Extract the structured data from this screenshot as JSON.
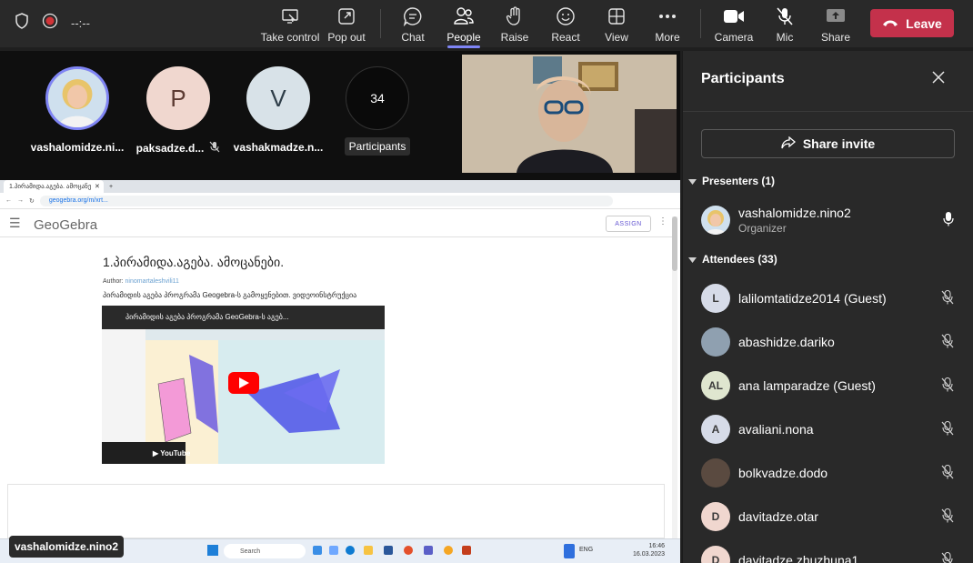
{
  "topbar": {
    "timer": "--:--",
    "buttons": {
      "take_control": "Take control",
      "pop_out": "Pop out",
      "chat": "Chat",
      "people": "People",
      "raise": "Raise",
      "react": "React",
      "view": "View",
      "more": "More",
      "camera": "Camera",
      "mic": "Mic",
      "share": "Share"
    },
    "leave": "Leave"
  },
  "stage": {
    "tiles": [
      {
        "name": "vashalomidze.ni...",
        "initial": ""
      },
      {
        "name": "paksadze.d...",
        "initial": "P"
      },
      {
        "name": "vashakmadze.n...",
        "initial": "V"
      },
      {
        "name": "Participants",
        "initial": "34"
      }
    ],
    "shared": {
      "tab_title": "1.პირამიდა.აგება. ამოცანები.",
      "url": "geogebra.org/m/xrt...",
      "logo": "GeoGebra",
      "assign": "ASSIGN",
      "doc_title": "1.პირამიდა.აგება. ამოცანები.",
      "author_label": "Author:",
      "author": "ninomartaleshvili11",
      "description": "პირამიდის აგება პროგრამა Geogebra-ს გამოყენებით. ვიდეოინსტრუქცია",
      "video_title": "პირამიდის აგება პროგრამა GeoGebra-ს აგებ...",
      "search_placeholder": "Search",
      "clock_time": "16:46",
      "clock_date": "16.03.2023",
      "lang": "ENG"
    },
    "presenter_tag": "vashalomidze.nino2"
  },
  "panel": {
    "title": "Participants",
    "share_invite": "Share invite",
    "presenters_label": "Presenters (1)",
    "attendees_label": "Attendees (33)",
    "presenters": [
      {
        "name": "vashalomidze.nino2",
        "role": "Organizer",
        "initials": ""
      }
    ],
    "attendees": [
      {
        "name": "lalilomtatidze2014 (Guest)",
        "initials": "L",
        "color": "#d6dbe8"
      },
      {
        "name": "abashidze.dariko",
        "initials": "",
        "color": "#8fa0b0"
      },
      {
        "name": "ana lamparadze (Guest)",
        "initials": "AL",
        "color": "#dfe6cf"
      },
      {
        "name": "avaliani.nona",
        "initials": "A",
        "color": "#d6dbe8"
      },
      {
        "name": "bolkvadze.dodo",
        "initials": "",
        "color": "#5a4a40"
      },
      {
        "name": "davitadze.otar",
        "initials": "D",
        "color": "#f0d7cf"
      },
      {
        "name": "davitadze.zhuzhuna1",
        "initials": "D",
        "color": "#f0d7cf"
      }
    ]
  }
}
